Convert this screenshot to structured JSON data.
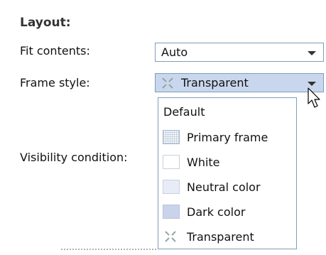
{
  "layout": {
    "section_title": "Layout:",
    "fit_contents": {
      "label": "Fit contents:",
      "value": "Auto"
    },
    "frame_style": {
      "label": "Frame style:",
      "value": "Transparent",
      "value_icon": "transparent-x-icon",
      "options": [
        {
          "label": "Default",
          "icon": ""
        },
        {
          "label": "Primary frame",
          "icon": "primary-frame-swatch"
        },
        {
          "label": "White",
          "icon": "white-swatch"
        },
        {
          "label": "Neutral color",
          "icon": "neutral-color-swatch"
        },
        {
          "label": "Dark color",
          "icon": "dark-color-swatch"
        },
        {
          "label": "Transparent",
          "icon": "transparent-x-icon"
        }
      ]
    },
    "visibility_condition": {
      "label": "Visibility condition:"
    }
  },
  "colors": {
    "combo_border": "#7f9db9",
    "active_combo_bg": "#c9d7ee",
    "neutral_swatch": "#e8ecf7",
    "dark_swatch": "#c9d3ea"
  }
}
